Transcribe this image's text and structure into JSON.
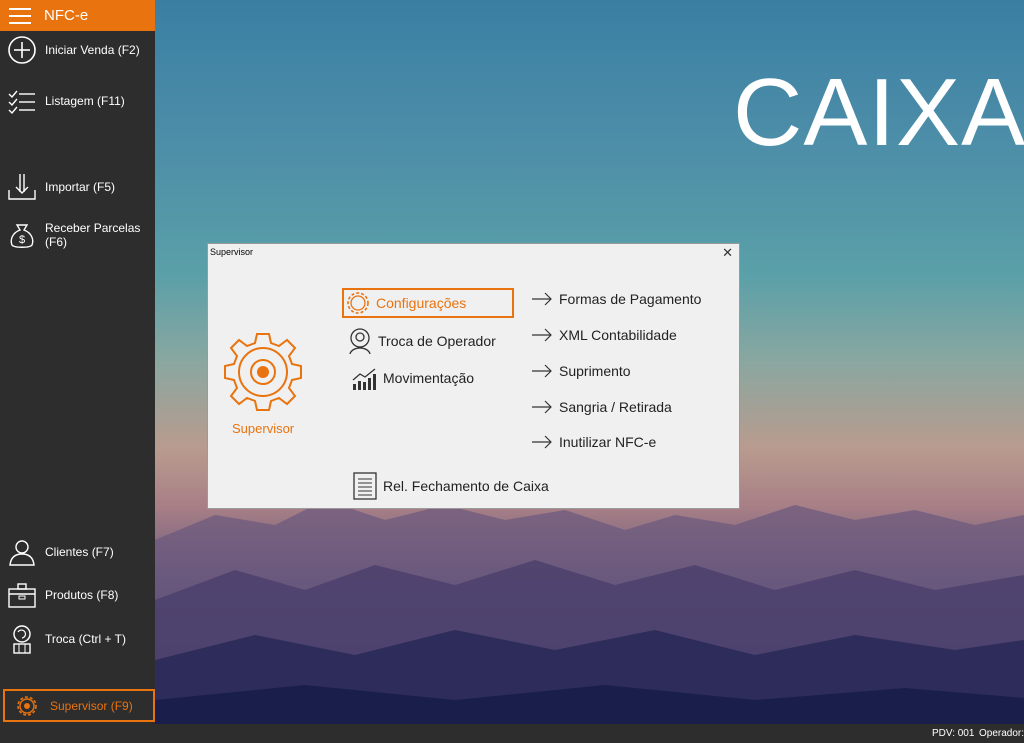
{
  "app": {
    "title": "NFC-e",
    "background_title": "CAIXA"
  },
  "sidebar": {
    "items": [
      {
        "label": "Iniciar Venda (F2)",
        "icon": "plus-circle-icon"
      },
      {
        "label": "Listagem (F11)",
        "icon": "checklist-icon"
      },
      {
        "label": "Importar (F5)",
        "icon": "import-icon"
      },
      {
        "label": "Receber Parcelas (F6)",
        "icon": "money-bag-icon"
      },
      {
        "label": "Clientes (F7)",
        "icon": "user-icon"
      },
      {
        "label": "Produtos (F8)",
        "icon": "box-icon"
      },
      {
        "label": "Troca (Ctrl + T)",
        "icon": "exchange-icon"
      },
      {
        "label": "Supervisor (F9)",
        "icon": "gear-icon"
      }
    ]
  },
  "dialog": {
    "title": "Supervisor",
    "close": "✕",
    "supervisor_label": "Supervisor",
    "actions": {
      "configuracoes": "Configurações",
      "troca_operador": "Troca de Operador",
      "movimentacao": "Movimentação",
      "rel_fechamento": "Rel. Fechamento de Caixa"
    },
    "links": [
      "Formas de Pagamento",
      "XML Contabilidade",
      "Suprimento",
      "Sangria / Retirada",
      "Inutilizar NFC-e"
    ]
  },
  "status": {
    "pdv": "PDV: 001",
    "operator": "Operador:"
  },
  "colors": {
    "accent": "#e8730f",
    "sidebar": "#2d2d2d"
  }
}
